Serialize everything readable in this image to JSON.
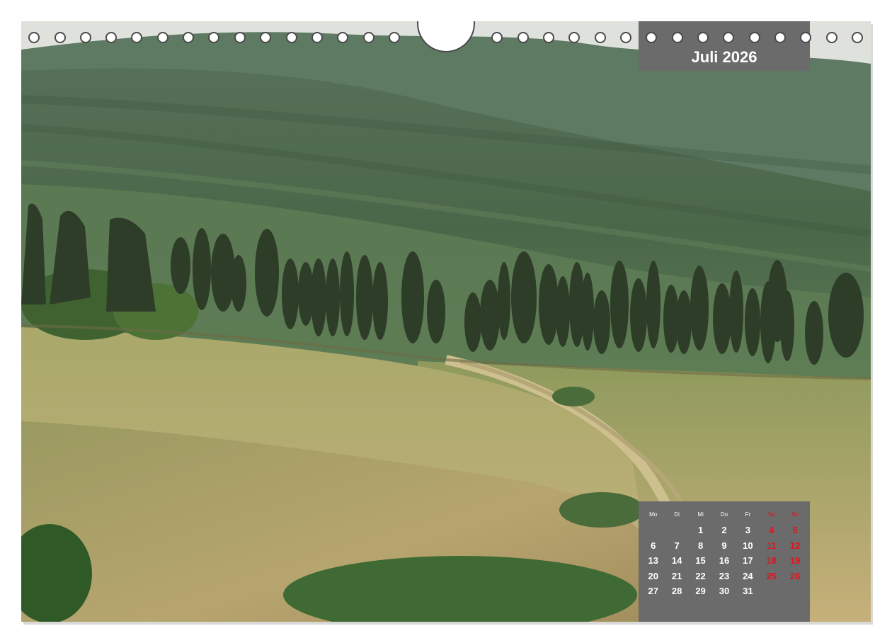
{
  "calendar": {
    "month_title": "Juli 2026",
    "weekdays": [
      "Mo",
      "Di",
      "Mi",
      "Do",
      "Fr",
      "Sa",
      "So"
    ],
    "weeks": [
      [
        "",
        "",
        "1",
        "2",
        "3",
        "4",
        "5"
      ],
      [
        "6",
        "7",
        "8",
        "9",
        "10",
        "11",
        "12"
      ],
      [
        "13",
        "14",
        "15",
        "16",
        "17",
        "18",
        "19"
      ],
      [
        "20",
        "21",
        "22",
        "23",
        "24",
        "25",
        "26"
      ],
      [
        "27",
        "28",
        "29",
        "30",
        "31",
        "",
        ""
      ]
    ],
    "colors": {
      "panel": "#6b6b6b",
      "weekday_text": "#ffffff",
      "weekend_text": "#e0141e"
    }
  },
  "photo": {
    "subject": "cypress-row-tuscan-hills",
    "colors": {
      "hills": "#4f6a4a",
      "far_hills": "#5f7a63",
      "field": "#b9ae73",
      "cypress": "#2e3d28",
      "sky": "#dfe2dc"
    }
  }
}
